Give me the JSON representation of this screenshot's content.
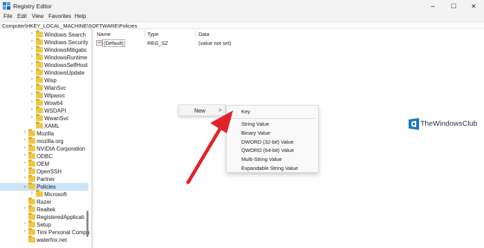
{
  "window": {
    "title": "Registry Editor",
    "minimize_glyph": "–",
    "maximize_glyph": "☐",
    "close_glyph": "✕"
  },
  "menubar": [
    "File",
    "Edit",
    "View",
    "Favorites",
    "Help"
  ],
  "address": "Computer\\HKEY_LOCAL_MACHINE\\SOFTWARE\\Policies",
  "tree": {
    "items": [
      {
        "label": "Windows Search",
        "expander": "›"
      },
      {
        "label": "Windows Security",
        "expander": "›"
      },
      {
        "label": "WindowsMitigatic",
        "expander": "›"
      },
      {
        "label": "WindowsRuntime",
        "expander": "›"
      },
      {
        "label": "WindowsSelfHost",
        "expander": "›"
      },
      {
        "label": "WindowsUpdate",
        "expander": "›"
      },
      {
        "label": "Wisp",
        "expander": "›"
      },
      {
        "label": "WlanSvc",
        "expander": "›"
      },
      {
        "label": "Wlpasvc",
        "expander": "›"
      },
      {
        "label": "Wow64",
        "expander": "›"
      },
      {
        "label": "WSDAPI",
        "expander": "›"
      },
      {
        "label": "WwanSvc",
        "expander": "›"
      },
      {
        "label": "XAML",
        "expander": ""
      },
      {
        "label": "Mozilla",
        "expander": "›"
      },
      {
        "label": "mozilla.org",
        "expander": "›"
      },
      {
        "label": "NVIDIA Corporation",
        "expander": "›"
      },
      {
        "label": "ODBC",
        "expander": "›"
      },
      {
        "label": "OEM",
        "expander": "›"
      },
      {
        "label": "OpenSSH",
        "expander": "›"
      },
      {
        "label": "Partner",
        "expander": "›"
      },
      {
        "label": "Policies",
        "expander": "⌄",
        "selected": true
      },
      {
        "label": "Microsoft",
        "expander": "›"
      },
      {
        "label": "Razer",
        "expander": ""
      },
      {
        "label": "Realtek",
        "expander": "›"
      },
      {
        "label": "RegisteredApplicati",
        "expander": ""
      },
      {
        "label": "Setup",
        "expander": "›"
      },
      {
        "label": "Timi Personal Compu",
        "expander": "›"
      },
      {
        "label": "waterfox.net",
        "expander": ""
      }
    ]
  },
  "list": {
    "columns": [
      "Name",
      "Type",
      "Data"
    ],
    "rows": [
      {
        "name": "(Default)",
        "type": "REG_SZ",
        "data": "(value not set)",
        "icon": "ab"
      }
    ]
  },
  "context_menu": {
    "new_label": "New",
    "new_arrow": ">"
  },
  "submenu": {
    "key_label": "Key",
    "items": [
      "String Value",
      "Binary Value",
      "DWORD (32-bit) Value",
      "QWORD (64-bit) Value",
      "Multi-String Value",
      "Expandable String Value"
    ]
  },
  "watermark": {
    "text": "TheWindowsClub"
  },
  "colors": {
    "arrow": "#e0242b",
    "folder": "#f0c645",
    "selection": "#cce4f7",
    "logo_blue": "#1a73c8"
  }
}
